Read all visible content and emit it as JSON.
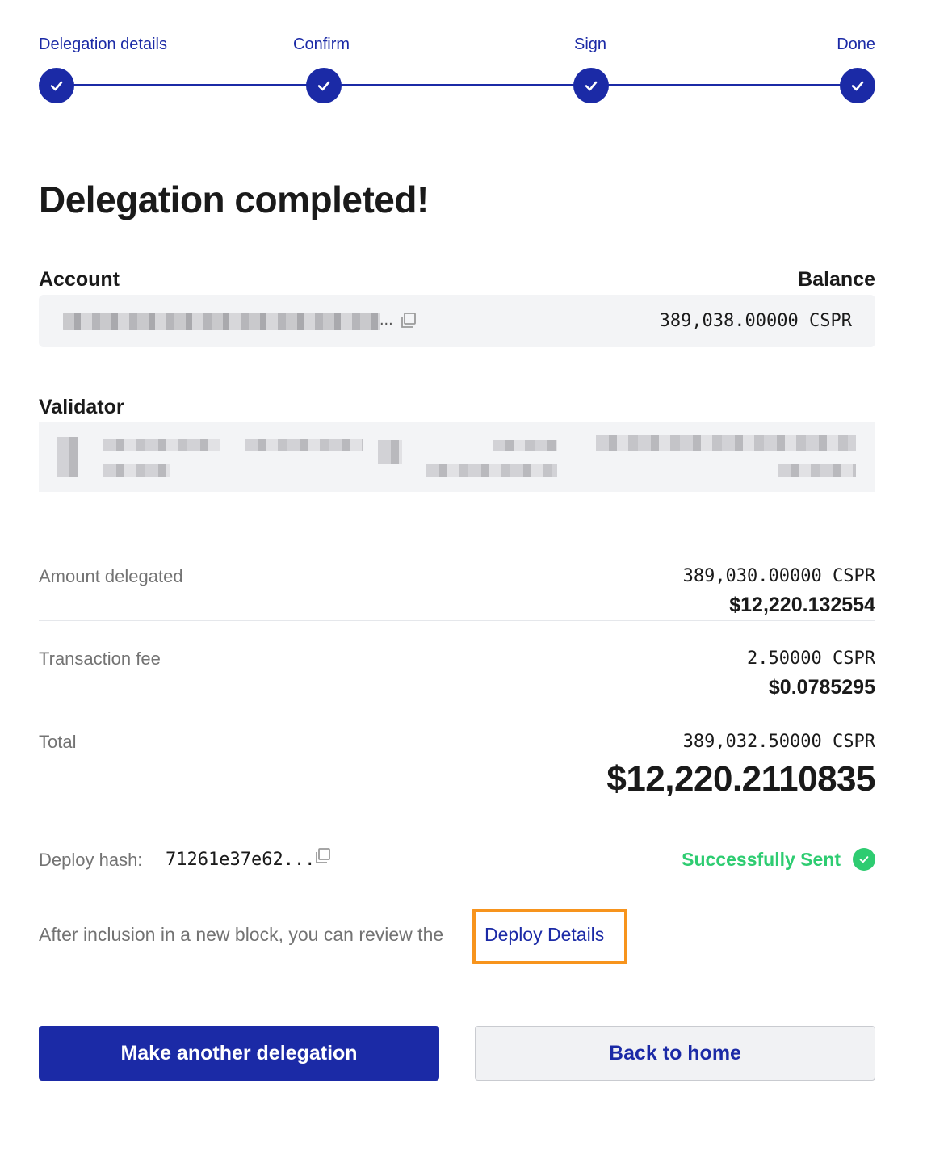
{
  "stepper": {
    "steps": [
      {
        "label": "Delegation details",
        "state": "done"
      },
      {
        "label": "Confirm",
        "state": "done"
      },
      {
        "label": "Sign",
        "state": "done"
      },
      {
        "label": "Done",
        "state": "done"
      }
    ],
    "accent_color": "#1b2aa6"
  },
  "page_title": "Delegation completed!",
  "account": {
    "label": "Account",
    "balance_label": "Balance",
    "ellipsis": "...",
    "balance_value": "389,038.00000 CSPR"
  },
  "validator": {
    "label": "Validator"
  },
  "amount_delegated": {
    "label": "Amount delegated",
    "cspr": "389,030.00000 CSPR",
    "usd": "$12,220.132554"
  },
  "transaction_fee": {
    "label": "Transaction fee",
    "cspr": "2.50000 CSPR",
    "usd": "$0.0785295"
  },
  "total": {
    "label": "Total",
    "cspr": "389,032.50000 CSPR",
    "usd": "$12,220.2110835"
  },
  "deploy": {
    "hash_label": "Deploy hash:",
    "hash_value": "71261e37e62...",
    "status": "Successfully Sent",
    "status_color": "#2ecc71"
  },
  "info": {
    "text": "After inclusion in a new block, you can review the",
    "link_label": "Deploy Details"
  },
  "buttons": {
    "primary_label": "Make another delegation",
    "secondary_label": "Back to home"
  },
  "icons": {
    "step_check": "check-icon",
    "copy": "copy-icon",
    "status": "check-circle-icon"
  }
}
